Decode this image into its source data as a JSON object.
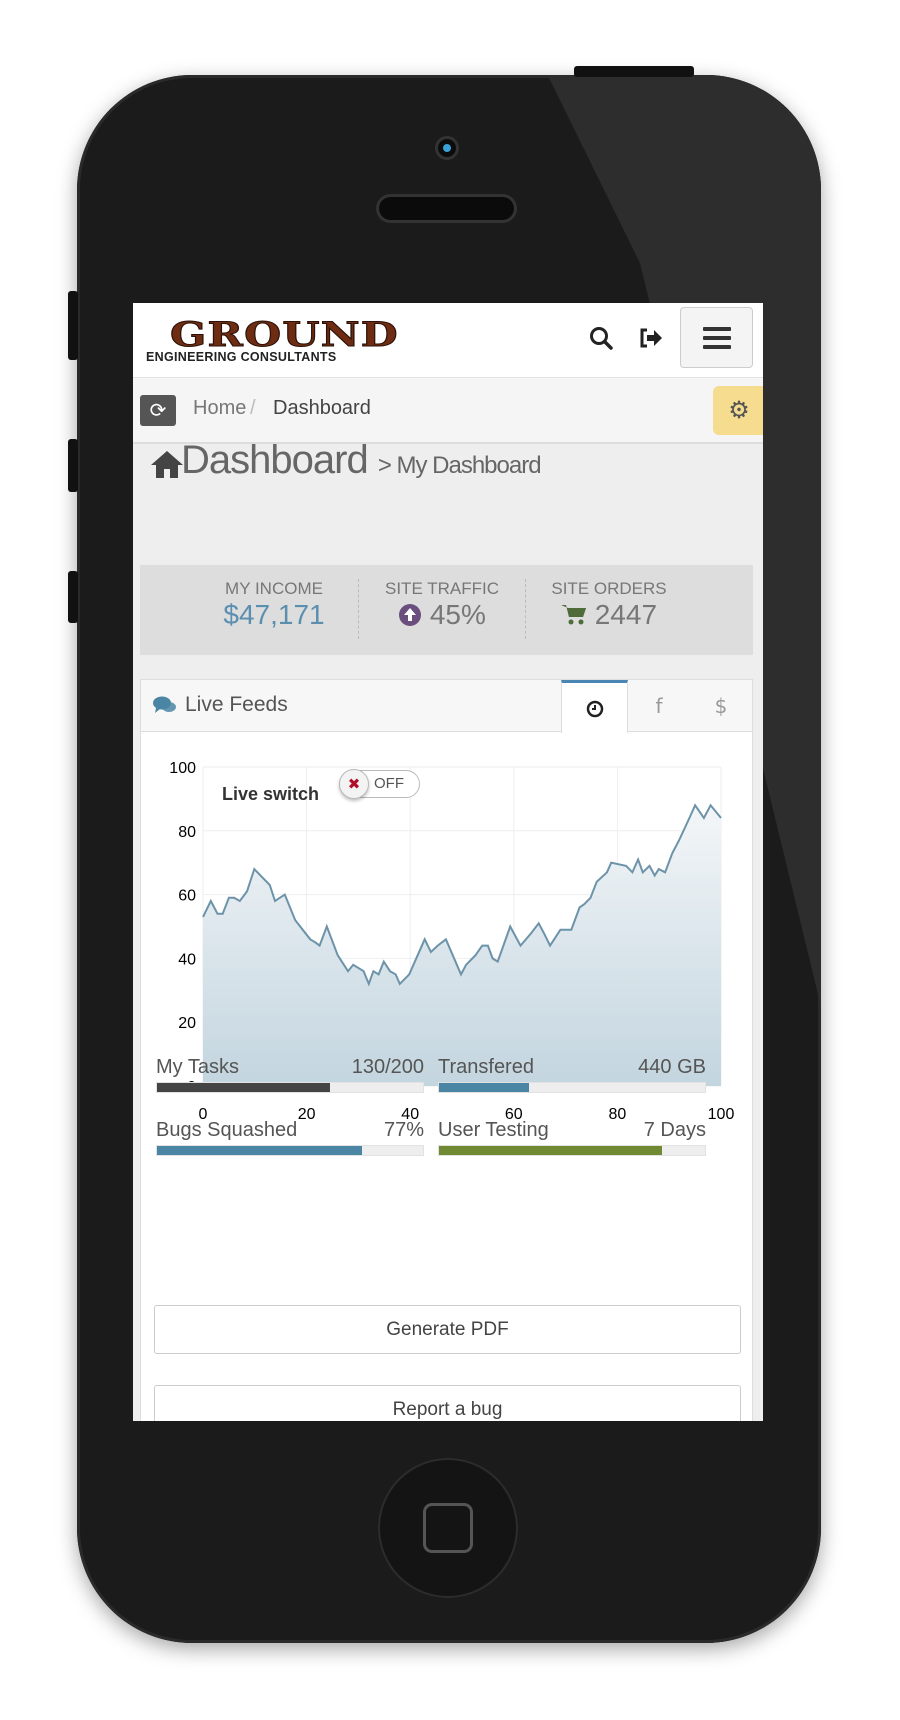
{
  "header": {
    "logo_title": "GROUND",
    "logo_subtitle": "ENGINEERING CONSULTANTS",
    "search_icon": "search-icon",
    "signout_icon": "sign-out-icon",
    "menu_icon": "hamburger-menu-icon"
  },
  "breadcrumb": {
    "items": [
      "Home",
      "Dashboard"
    ],
    "separator": "/"
  },
  "page": {
    "title": "Dashboard",
    "subtitle": "> My Dashboard"
  },
  "stats": [
    {
      "label": "MY INCOME",
      "value": "$47,171",
      "icon": "",
      "color": "#5b8fb0"
    },
    {
      "label": "SITE TRAFFIC",
      "value": "45%",
      "icon": "arrow-circle-up-icon",
      "color": "#6a4f7e"
    },
    {
      "label": "SITE ORDERS",
      "value": "2447",
      "icon": "shopping-cart-icon",
      "color": "#4f6b3a"
    }
  ],
  "panel": {
    "title": "Live Feeds",
    "tabs": [
      "clock-icon",
      "facebook-icon",
      "dollar-icon"
    ],
    "active_tab": 0,
    "live_switch": {
      "label": "Live switch",
      "state": "OFF"
    }
  },
  "chart_data": {
    "type": "area",
    "xlim": [
      0,
      100
    ],
    "ylim": [
      0,
      100
    ],
    "xticks": [
      "0",
      "20",
      "40",
      "60",
      "80",
      "100"
    ],
    "yticks": [
      "0",
      "20",
      "40",
      "60",
      "80",
      "100"
    ],
    "grid": true,
    "line_color": "#6d93a8",
    "fill_color": "#c3d5df",
    "x": [
      0,
      1.5,
      2.8,
      3.8,
      5,
      6,
      7.1,
      8.5,
      9.9,
      12.9,
      13.9,
      15.8,
      17.8,
      20.7,
      21.7,
      22.5,
      23.9,
      26,
      28,
      29,
      31,
      32,
      32.9,
      33.9,
      34.9,
      36.1,
      37.2,
      38,
      39.8,
      42.8,
      44,
      45.3,
      46.9,
      49.8,
      50.8,
      52.6,
      53.9,
      55,
      55.9,
      56.9,
      59.3,
      61.3,
      63.4,
      64.8,
      65.8,
      67,
      69,
      70.3,
      71.1,
      72.7,
      73.6,
      74.8,
      76,
      78,
      78.8,
      81.7,
      82.9,
      84,
      84.9,
      86.2,
      87.2,
      88,
      89.2,
      90.6,
      91.9,
      93.9,
      95,
      96.7,
      98,
      100
    ],
    "y": [
      53,
      58,
      54,
      54,
      59,
      59,
      58,
      61,
      68,
      63,
      58,
      60,
      52,
      46,
      45,
      44,
      50,
      41,
      36,
      38,
      36,
      32,
      36,
      35,
      39,
      36,
      35,
      32,
      35,
      46,
      42,
      44,
      46,
      35,
      38,
      41,
      44,
      44,
      40,
      39,
      50,
      44,
      48,
      51,
      48,
      44,
      49,
      49,
      49,
      56,
      57,
      59,
      64,
      67,
      70,
      69,
      67,
      71,
      67,
      69,
      66,
      68,
      67,
      73,
      77,
      84,
      88,
      84,
      88,
      84
    ]
  },
  "progress": [
    {
      "label": "My Tasks",
      "value": "130/200",
      "fraction": 0.65,
      "color": "#444444"
    },
    {
      "label": "Transfered",
      "value": "440 GB",
      "fraction": 0.34,
      "color": "#4a86a4"
    },
    {
      "label": "Bugs Squashed",
      "value": "77%",
      "fraction": 0.77,
      "color": "#4a86a4"
    },
    {
      "label": "User Testing",
      "value": "7 Days",
      "fraction": 0.84,
      "color": "#6f8a33"
    }
  ],
  "buttons": {
    "generate_pdf": "Generate PDF",
    "report_bug": "Report a bug"
  }
}
